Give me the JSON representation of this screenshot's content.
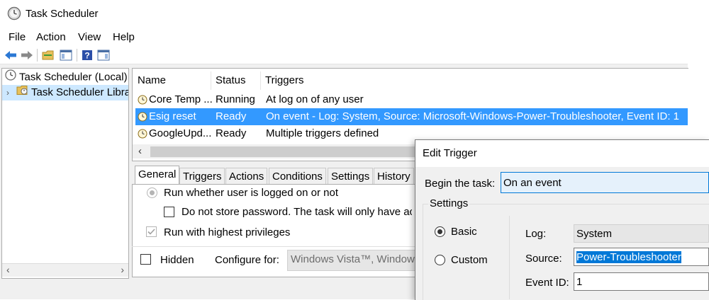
{
  "window": {
    "title": "Task Scheduler"
  },
  "menu": [
    "File",
    "Action",
    "View",
    "Help"
  ],
  "toolbar": {
    "icons": [
      "back-arrow-icon",
      "forward-arrow-icon",
      "folder-icon",
      "show-hide-console-tree-icon",
      "help-icon",
      "show-hide-action-pane-icon"
    ]
  },
  "tree": {
    "root": "Task Scheduler (Local)",
    "child": "Task Scheduler Libra"
  },
  "tasks": {
    "columns": [
      "Name",
      "Status",
      "Triggers"
    ],
    "rows": [
      {
        "name": "Core Temp ...",
        "status": "Running",
        "triggers": "At log on of any user"
      },
      {
        "name": "Esig reset",
        "status": "Ready",
        "triggers": "On event - Log: System, Source: Microsoft-Windows-Power-Troubleshooter, Event ID: 1"
      },
      {
        "name": "GoogleUpd...",
        "status": "Ready",
        "triggers": "Multiple triggers defined"
      }
    ]
  },
  "tabs": [
    "General",
    "Triggers",
    "Actions",
    "Conditions",
    "Settings",
    "History"
  ],
  "general": {
    "run_whether": "Run whether user is logged on or not",
    "no_store_pw": "Do not store password.  The task will only have ac",
    "highest": "Run with highest privileges",
    "hidden": "Hidden",
    "configure_label": "Configure for:",
    "configure_value": "Windows Vista™, Windows"
  },
  "dialog": {
    "title": "Edit Trigger",
    "begin_label": "Begin the task:",
    "begin_value": "On an event",
    "settings_label": "Settings",
    "basic": "Basic",
    "custom": "Custom",
    "log_label": "Log:",
    "log_value": "System",
    "source_label": "Source:",
    "source_value": "Power-Troubleshooter",
    "eventid_label": "Event ID:",
    "eventid_value": "1"
  },
  "colors": {
    "selection": "#3399ff",
    "tree_selection": "#cde8ff",
    "accent": "#0078d7"
  }
}
